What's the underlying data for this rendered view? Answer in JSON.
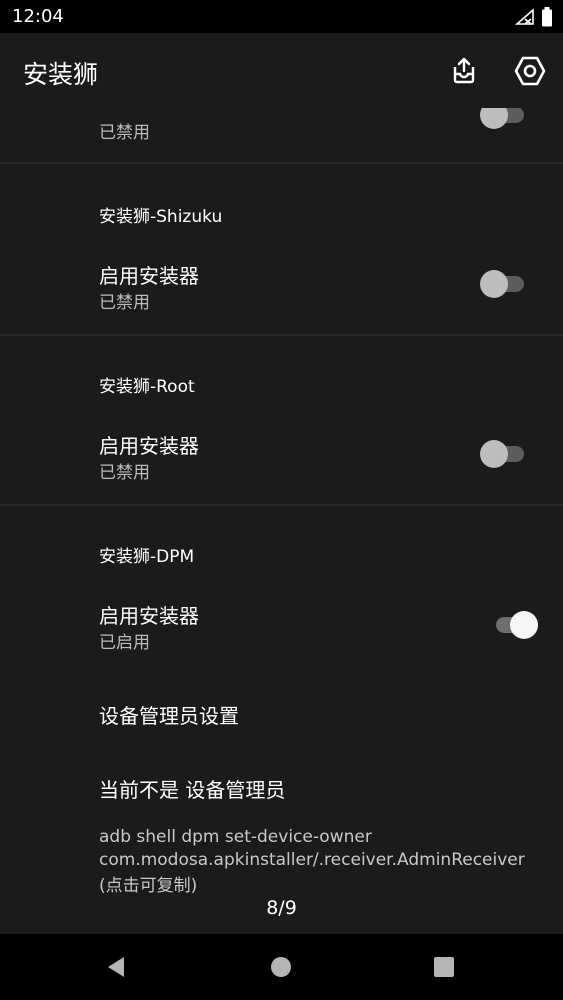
{
  "status_bar": {
    "time": "12:04"
  },
  "app_bar": {
    "title": "安装狮"
  },
  "partial_item": {
    "subtitle": "已禁用",
    "switch_on": false
  },
  "sections": [
    {
      "title": "安装狮-Shizuku",
      "item_title": "启用安装器",
      "item_subtitle": "已禁用",
      "switch_on": false
    },
    {
      "title": "安装狮-Root",
      "item_title": "启用安装器",
      "item_subtitle": "已禁用",
      "switch_on": false
    },
    {
      "title": "安装狮-DPM",
      "item_title": "启用安装器",
      "item_subtitle": "已启用",
      "switch_on": true
    }
  ],
  "dpm": {
    "admin_settings": "设备管理员设置",
    "status": "当前不是 设备管理员",
    "command_line1": "adb shell dpm set-device-owner",
    "command_line2": "com.modosa.apkinstaller/.receiver.AdminReceiver",
    "copy_hint": "(点击可复制)"
  },
  "page_indicator": "8/9",
  "colors": {
    "background": "#1b1b1b",
    "status_bar": "#000000",
    "nav_bar": "#000000"
  }
}
